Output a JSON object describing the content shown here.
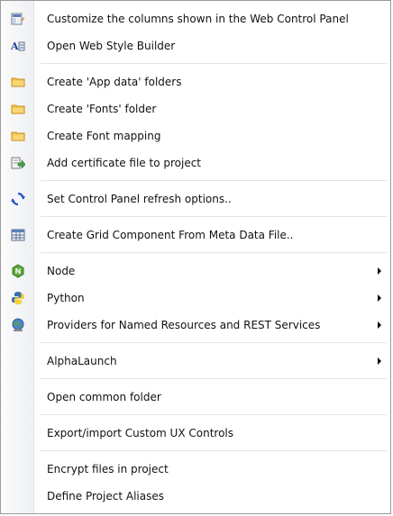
{
  "menu": {
    "items": [
      {
        "label": "Customize the columns shown in the Web Control Panel",
        "icon": "columns-icon"
      },
      {
        "label": "Open Web Style Builder",
        "icon": "style-builder-icon"
      },
      {
        "label": "Create 'App data' folders",
        "icon": "folder-icon"
      },
      {
        "label": "Create 'Fonts' folder",
        "icon": "folder-icon"
      },
      {
        "label": "Create Font mapping",
        "icon": "folder-icon"
      },
      {
        "label": "Add certificate file to project",
        "icon": "certificate-add-icon"
      },
      {
        "label": "Set Control Panel refresh options..",
        "icon": "refresh-icon"
      },
      {
        "label": "Create Grid Component From Meta Data File..",
        "icon": "grid-icon"
      },
      {
        "label": "Node",
        "icon": "node-icon"
      },
      {
        "label": "Python",
        "icon": "python-icon"
      },
      {
        "label": "Providers for Named Resources and REST Services",
        "icon": "globe-user-icon"
      },
      {
        "label": "AlphaLaunch",
        "icon": ""
      },
      {
        "label": "Open common folder",
        "icon": ""
      },
      {
        "label": "Export/import Custom UX Controls",
        "icon": ""
      },
      {
        "label": "Encrypt files in project",
        "icon": ""
      },
      {
        "label": "Define Project Aliases",
        "icon": ""
      }
    ]
  },
  "colors": {
    "folder": "#f2c14e",
    "refresh": "#2a56c6",
    "node": "#5aa63b",
    "python_blue": "#3c6fb0",
    "python_yellow": "#f2cf3a"
  }
}
